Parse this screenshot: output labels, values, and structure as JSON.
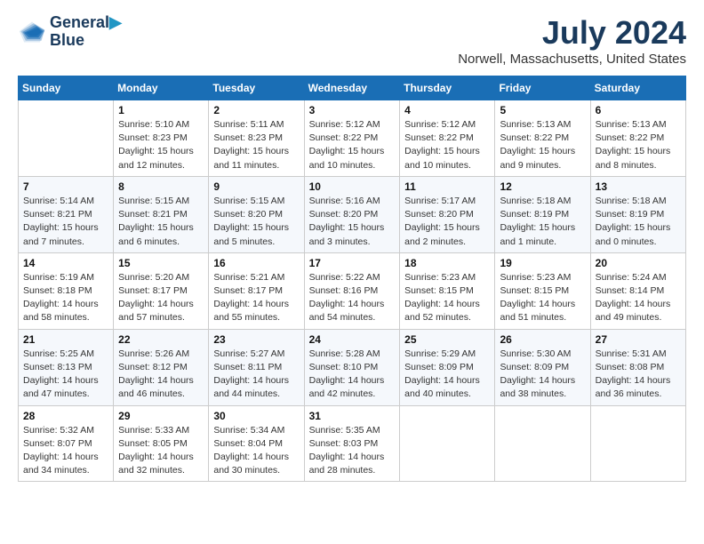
{
  "logo": {
    "line1": "General",
    "line2": "Blue"
  },
  "title": "July 2024",
  "subtitle": "Norwell, Massachusetts, United States",
  "days_header": [
    "Sunday",
    "Monday",
    "Tuesday",
    "Wednesday",
    "Thursday",
    "Friday",
    "Saturday"
  ],
  "weeks": [
    [
      {
        "day": "",
        "sunrise": "",
        "sunset": "",
        "daylight": ""
      },
      {
        "day": "1",
        "sunrise": "Sunrise: 5:10 AM",
        "sunset": "Sunset: 8:23 PM",
        "daylight": "Daylight: 15 hours and 12 minutes."
      },
      {
        "day": "2",
        "sunrise": "Sunrise: 5:11 AM",
        "sunset": "Sunset: 8:23 PM",
        "daylight": "Daylight: 15 hours and 11 minutes."
      },
      {
        "day": "3",
        "sunrise": "Sunrise: 5:12 AM",
        "sunset": "Sunset: 8:22 PM",
        "daylight": "Daylight: 15 hours and 10 minutes."
      },
      {
        "day": "4",
        "sunrise": "Sunrise: 5:12 AM",
        "sunset": "Sunset: 8:22 PM",
        "daylight": "Daylight: 15 hours and 10 minutes."
      },
      {
        "day": "5",
        "sunrise": "Sunrise: 5:13 AM",
        "sunset": "Sunset: 8:22 PM",
        "daylight": "Daylight: 15 hours and 9 minutes."
      },
      {
        "day": "6",
        "sunrise": "Sunrise: 5:13 AM",
        "sunset": "Sunset: 8:22 PM",
        "daylight": "Daylight: 15 hours and 8 minutes."
      }
    ],
    [
      {
        "day": "7",
        "sunrise": "Sunrise: 5:14 AM",
        "sunset": "Sunset: 8:21 PM",
        "daylight": "Daylight: 15 hours and 7 minutes."
      },
      {
        "day": "8",
        "sunrise": "Sunrise: 5:15 AM",
        "sunset": "Sunset: 8:21 PM",
        "daylight": "Daylight: 15 hours and 6 minutes."
      },
      {
        "day": "9",
        "sunrise": "Sunrise: 5:15 AM",
        "sunset": "Sunset: 8:20 PM",
        "daylight": "Daylight: 15 hours and 5 minutes."
      },
      {
        "day": "10",
        "sunrise": "Sunrise: 5:16 AM",
        "sunset": "Sunset: 8:20 PM",
        "daylight": "Daylight: 15 hours and 3 minutes."
      },
      {
        "day": "11",
        "sunrise": "Sunrise: 5:17 AM",
        "sunset": "Sunset: 8:20 PM",
        "daylight": "Daylight: 15 hours and 2 minutes."
      },
      {
        "day": "12",
        "sunrise": "Sunrise: 5:18 AM",
        "sunset": "Sunset: 8:19 PM",
        "daylight": "Daylight: 15 hours and 1 minute."
      },
      {
        "day": "13",
        "sunrise": "Sunrise: 5:18 AM",
        "sunset": "Sunset: 8:19 PM",
        "daylight": "Daylight: 15 hours and 0 minutes."
      }
    ],
    [
      {
        "day": "14",
        "sunrise": "Sunrise: 5:19 AM",
        "sunset": "Sunset: 8:18 PM",
        "daylight": "Daylight: 14 hours and 58 minutes."
      },
      {
        "day": "15",
        "sunrise": "Sunrise: 5:20 AM",
        "sunset": "Sunset: 8:17 PM",
        "daylight": "Daylight: 14 hours and 57 minutes."
      },
      {
        "day": "16",
        "sunrise": "Sunrise: 5:21 AM",
        "sunset": "Sunset: 8:17 PM",
        "daylight": "Daylight: 14 hours and 55 minutes."
      },
      {
        "day": "17",
        "sunrise": "Sunrise: 5:22 AM",
        "sunset": "Sunset: 8:16 PM",
        "daylight": "Daylight: 14 hours and 54 minutes."
      },
      {
        "day": "18",
        "sunrise": "Sunrise: 5:23 AM",
        "sunset": "Sunset: 8:15 PM",
        "daylight": "Daylight: 14 hours and 52 minutes."
      },
      {
        "day": "19",
        "sunrise": "Sunrise: 5:23 AM",
        "sunset": "Sunset: 8:15 PM",
        "daylight": "Daylight: 14 hours and 51 minutes."
      },
      {
        "day": "20",
        "sunrise": "Sunrise: 5:24 AM",
        "sunset": "Sunset: 8:14 PM",
        "daylight": "Daylight: 14 hours and 49 minutes."
      }
    ],
    [
      {
        "day": "21",
        "sunrise": "Sunrise: 5:25 AM",
        "sunset": "Sunset: 8:13 PM",
        "daylight": "Daylight: 14 hours and 47 minutes."
      },
      {
        "day": "22",
        "sunrise": "Sunrise: 5:26 AM",
        "sunset": "Sunset: 8:12 PM",
        "daylight": "Daylight: 14 hours and 46 minutes."
      },
      {
        "day": "23",
        "sunrise": "Sunrise: 5:27 AM",
        "sunset": "Sunset: 8:11 PM",
        "daylight": "Daylight: 14 hours and 44 minutes."
      },
      {
        "day": "24",
        "sunrise": "Sunrise: 5:28 AM",
        "sunset": "Sunset: 8:10 PM",
        "daylight": "Daylight: 14 hours and 42 minutes."
      },
      {
        "day": "25",
        "sunrise": "Sunrise: 5:29 AM",
        "sunset": "Sunset: 8:09 PM",
        "daylight": "Daylight: 14 hours and 40 minutes."
      },
      {
        "day": "26",
        "sunrise": "Sunrise: 5:30 AM",
        "sunset": "Sunset: 8:09 PM",
        "daylight": "Daylight: 14 hours and 38 minutes."
      },
      {
        "day": "27",
        "sunrise": "Sunrise: 5:31 AM",
        "sunset": "Sunset: 8:08 PM",
        "daylight": "Daylight: 14 hours and 36 minutes."
      }
    ],
    [
      {
        "day": "28",
        "sunrise": "Sunrise: 5:32 AM",
        "sunset": "Sunset: 8:07 PM",
        "daylight": "Daylight: 14 hours and 34 minutes."
      },
      {
        "day": "29",
        "sunrise": "Sunrise: 5:33 AM",
        "sunset": "Sunset: 8:05 PM",
        "daylight": "Daylight: 14 hours and 32 minutes."
      },
      {
        "day": "30",
        "sunrise": "Sunrise: 5:34 AM",
        "sunset": "Sunset: 8:04 PM",
        "daylight": "Daylight: 14 hours and 30 minutes."
      },
      {
        "day": "31",
        "sunrise": "Sunrise: 5:35 AM",
        "sunset": "Sunset: 8:03 PM",
        "daylight": "Daylight: 14 hours and 28 minutes."
      },
      {
        "day": "",
        "sunrise": "",
        "sunset": "",
        "daylight": ""
      },
      {
        "day": "",
        "sunrise": "",
        "sunset": "",
        "daylight": ""
      },
      {
        "day": "",
        "sunrise": "",
        "sunset": "",
        "daylight": ""
      }
    ]
  ]
}
